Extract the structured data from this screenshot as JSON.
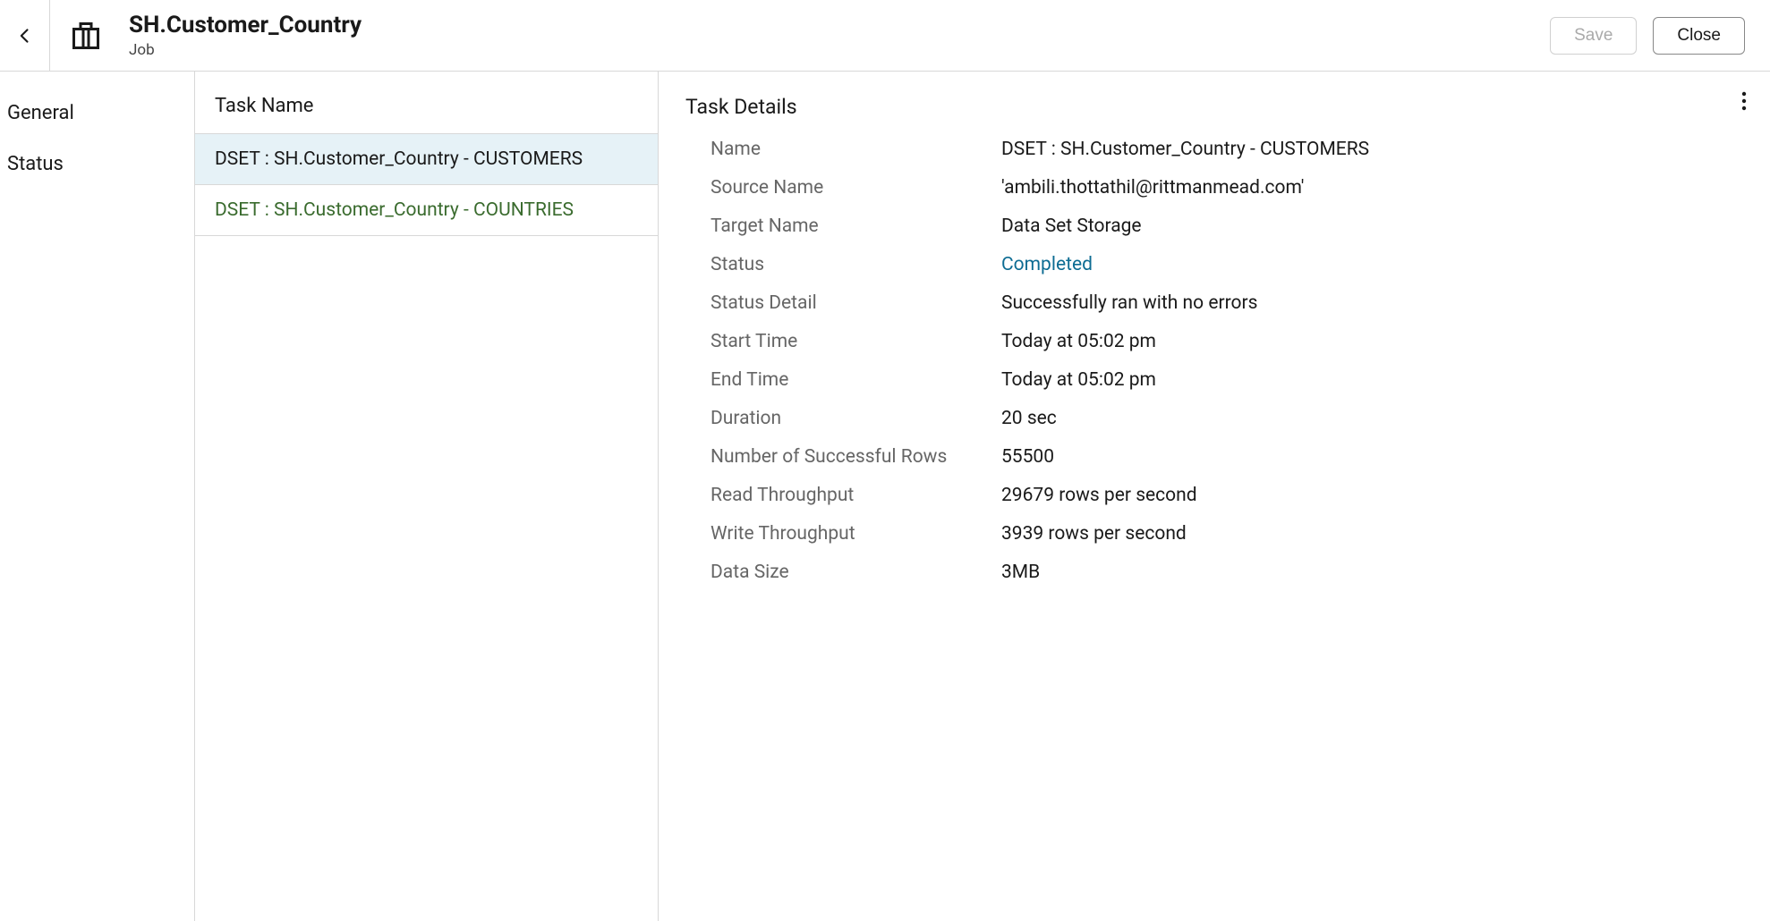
{
  "header": {
    "title": "SH.Customer_Country",
    "subtitle": "Job",
    "save_label": "Save",
    "close_label": "Close"
  },
  "sidebar": {
    "items": [
      {
        "label": "General"
      },
      {
        "label": "Status"
      }
    ]
  },
  "task_list": {
    "header": "Task Name",
    "items": [
      {
        "label": "DSET : SH.Customer_Country - CUSTOMERS",
        "selected": true
      },
      {
        "label": "DSET : SH.Customer_Country - COUNTRIES",
        "selected": false
      }
    ]
  },
  "details": {
    "title": "Task Details",
    "rows": [
      {
        "label": "Name",
        "value": "DSET : SH.Customer_Country - CUSTOMERS"
      },
      {
        "label": "Source Name",
        "value": "'ambili.thottathil@rittmanmead.com'"
      },
      {
        "label": "Target Name",
        "value": "Data Set Storage"
      },
      {
        "label": "Status",
        "value": "Completed",
        "status": true
      },
      {
        "label": "Status Detail",
        "value": "Successfully ran with no errors"
      },
      {
        "label": "Start Time",
        "value": "Today at 05:02 pm"
      },
      {
        "label": "End Time",
        "value": "Today at 05:02 pm"
      },
      {
        "label": "Duration",
        "value": "20 sec"
      },
      {
        "label": "Number of Successful Rows",
        "value": "55500"
      },
      {
        "label": "Read Throughput",
        "value": "29679 rows per second"
      },
      {
        "label": "Write Throughput",
        "value": "3939 rows per second"
      },
      {
        "label": "Data Size",
        "value": "3MB"
      }
    ]
  }
}
